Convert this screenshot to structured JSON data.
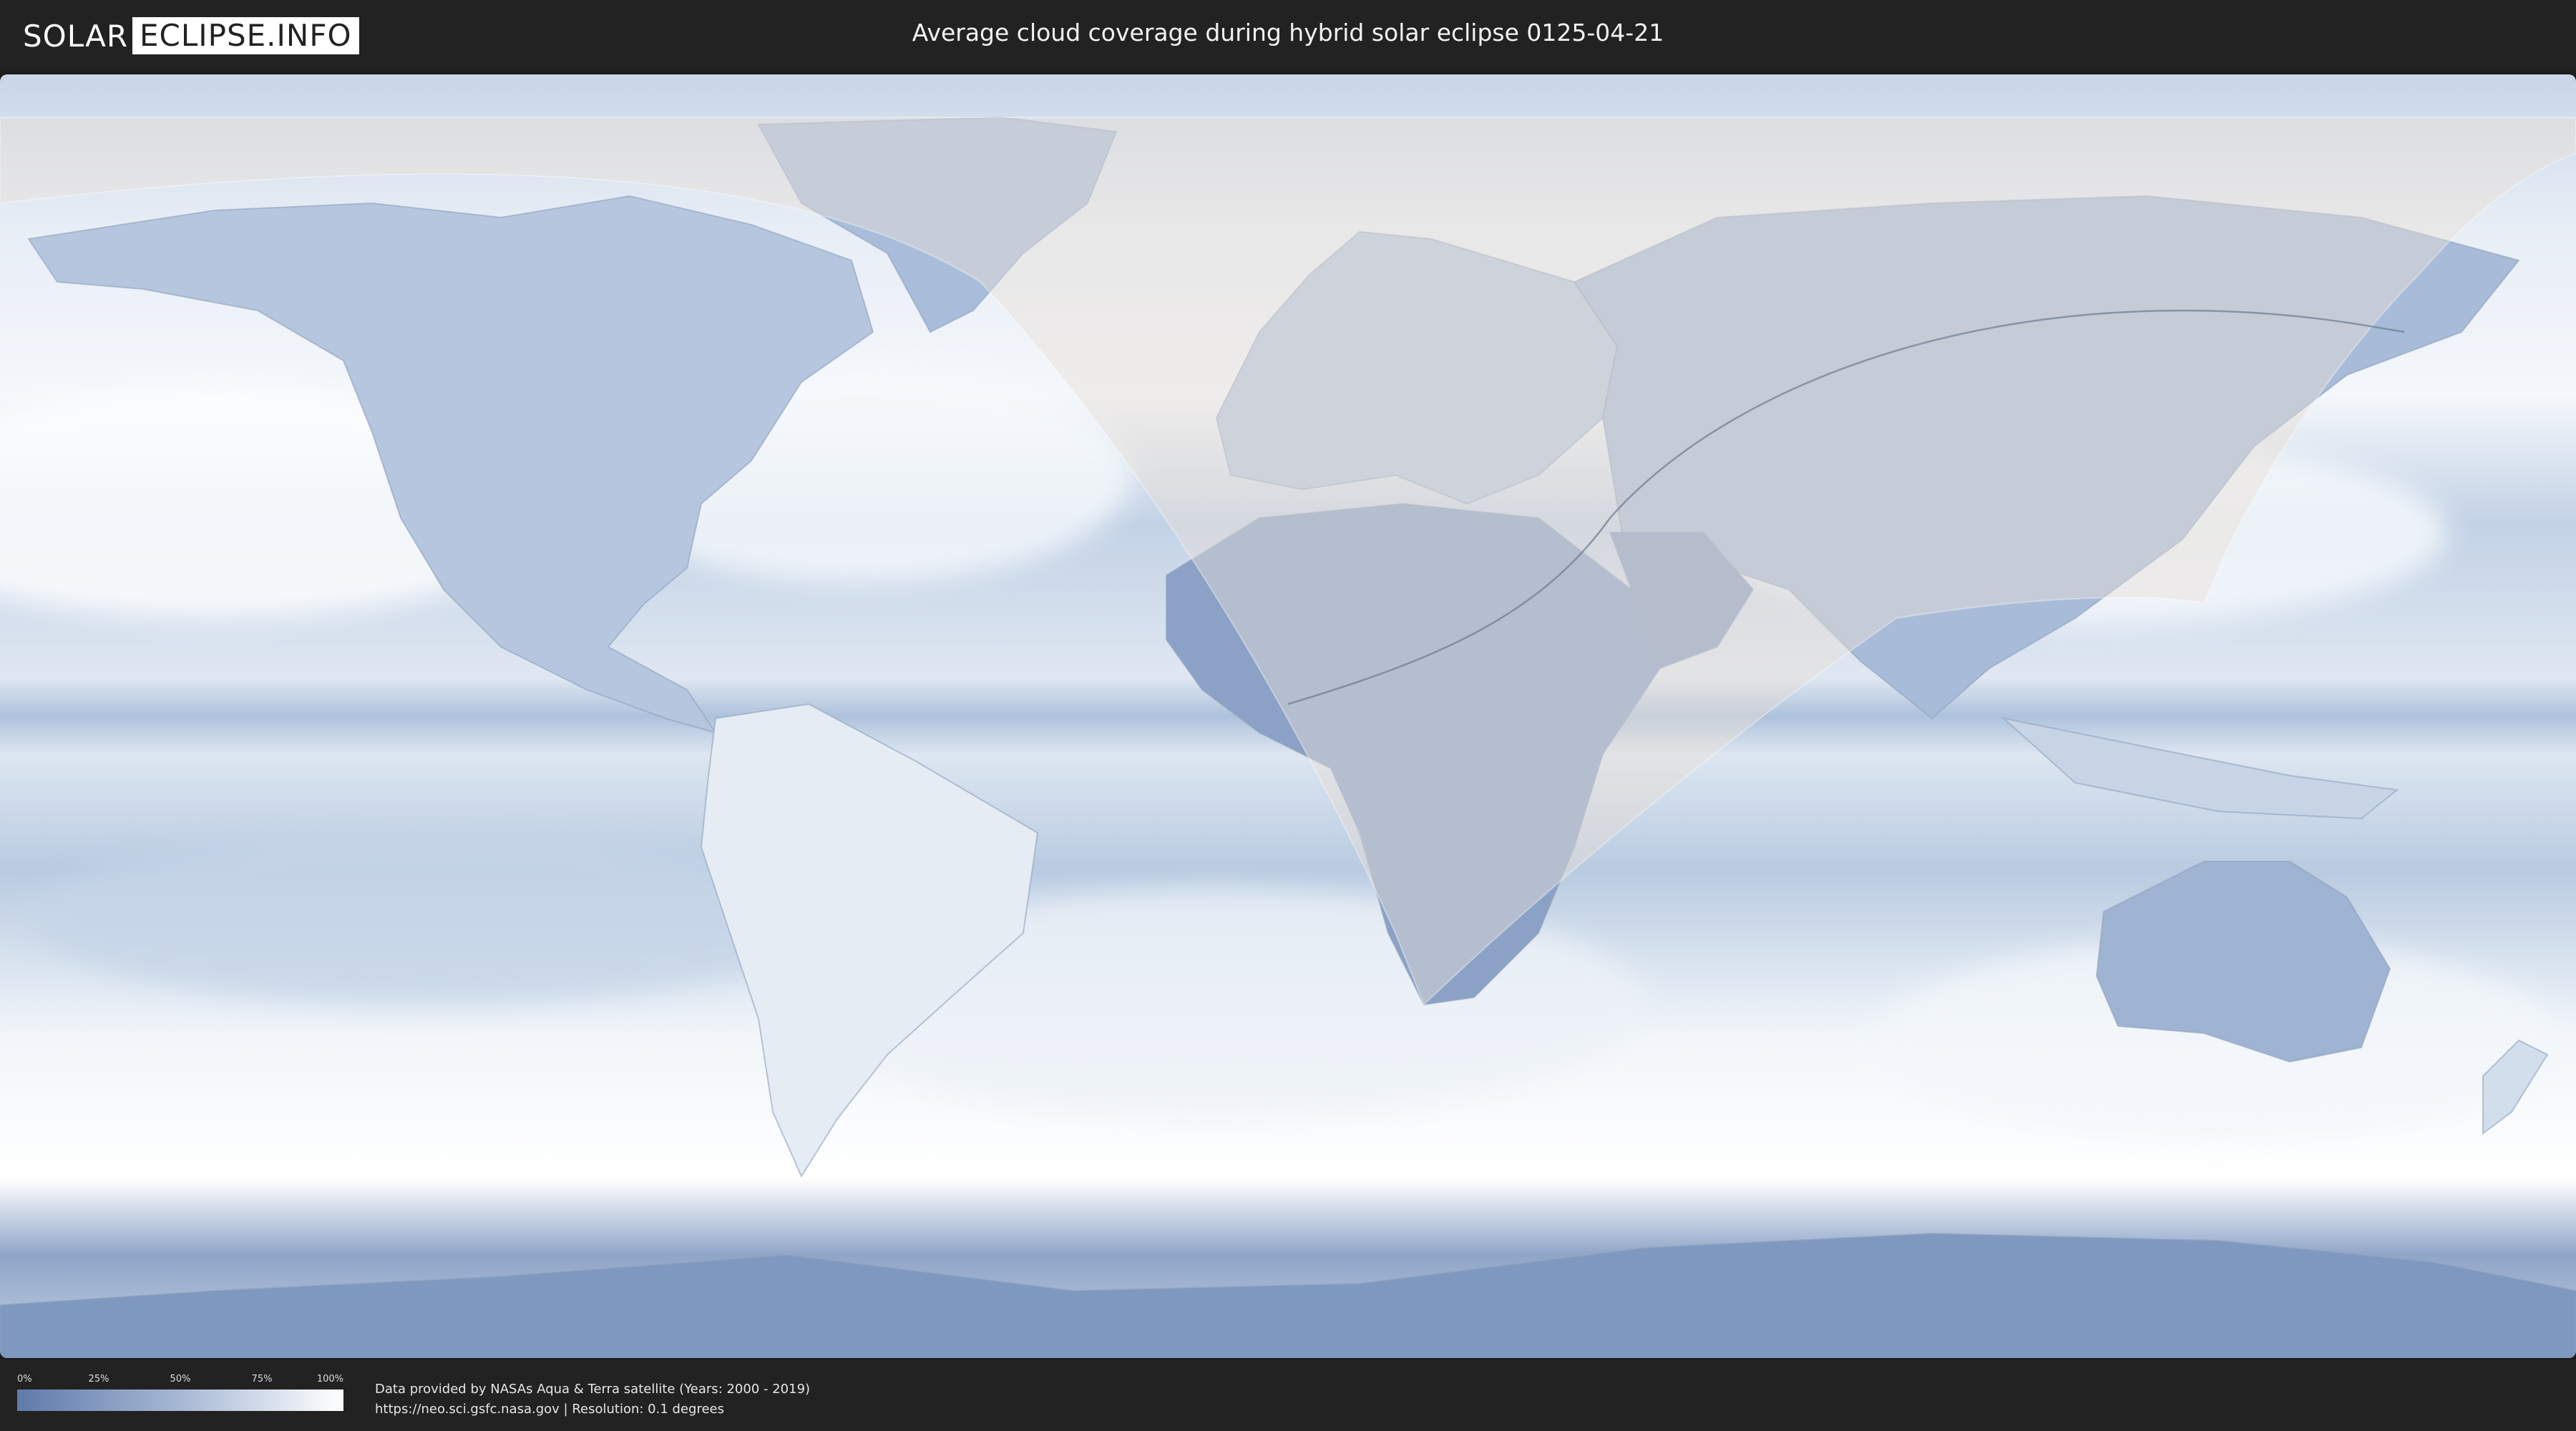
{
  "header": {
    "logo_left": "SOLAR",
    "logo_right": "ECLIPSE.INFO",
    "title": "Average cloud coverage during hybrid solar eclipse 0125-04-21"
  },
  "map": {
    "projection": "equirectangular",
    "ocean_color": "#b9cbe1",
    "clear_sky_color": "#5f7bab",
    "cloud_color": "#ffffff",
    "eclipse_overlay_color": "#e8e1d8"
  },
  "legend": {
    "ticks": [
      "0%",
      "25%",
      "50%",
      "75%",
      "100%"
    ],
    "gradient_start": "#5f7bab",
    "gradient_end": "#ffffff"
  },
  "footer": {
    "credit_line1": "Data provided by NASAs Aqua & Terra satellite (Years: 2000 - 2019)",
    "credit_line2": "https://neo.sci.gsfc.nasa.gov | Resolution: 0.1 degrees"
  }
}
